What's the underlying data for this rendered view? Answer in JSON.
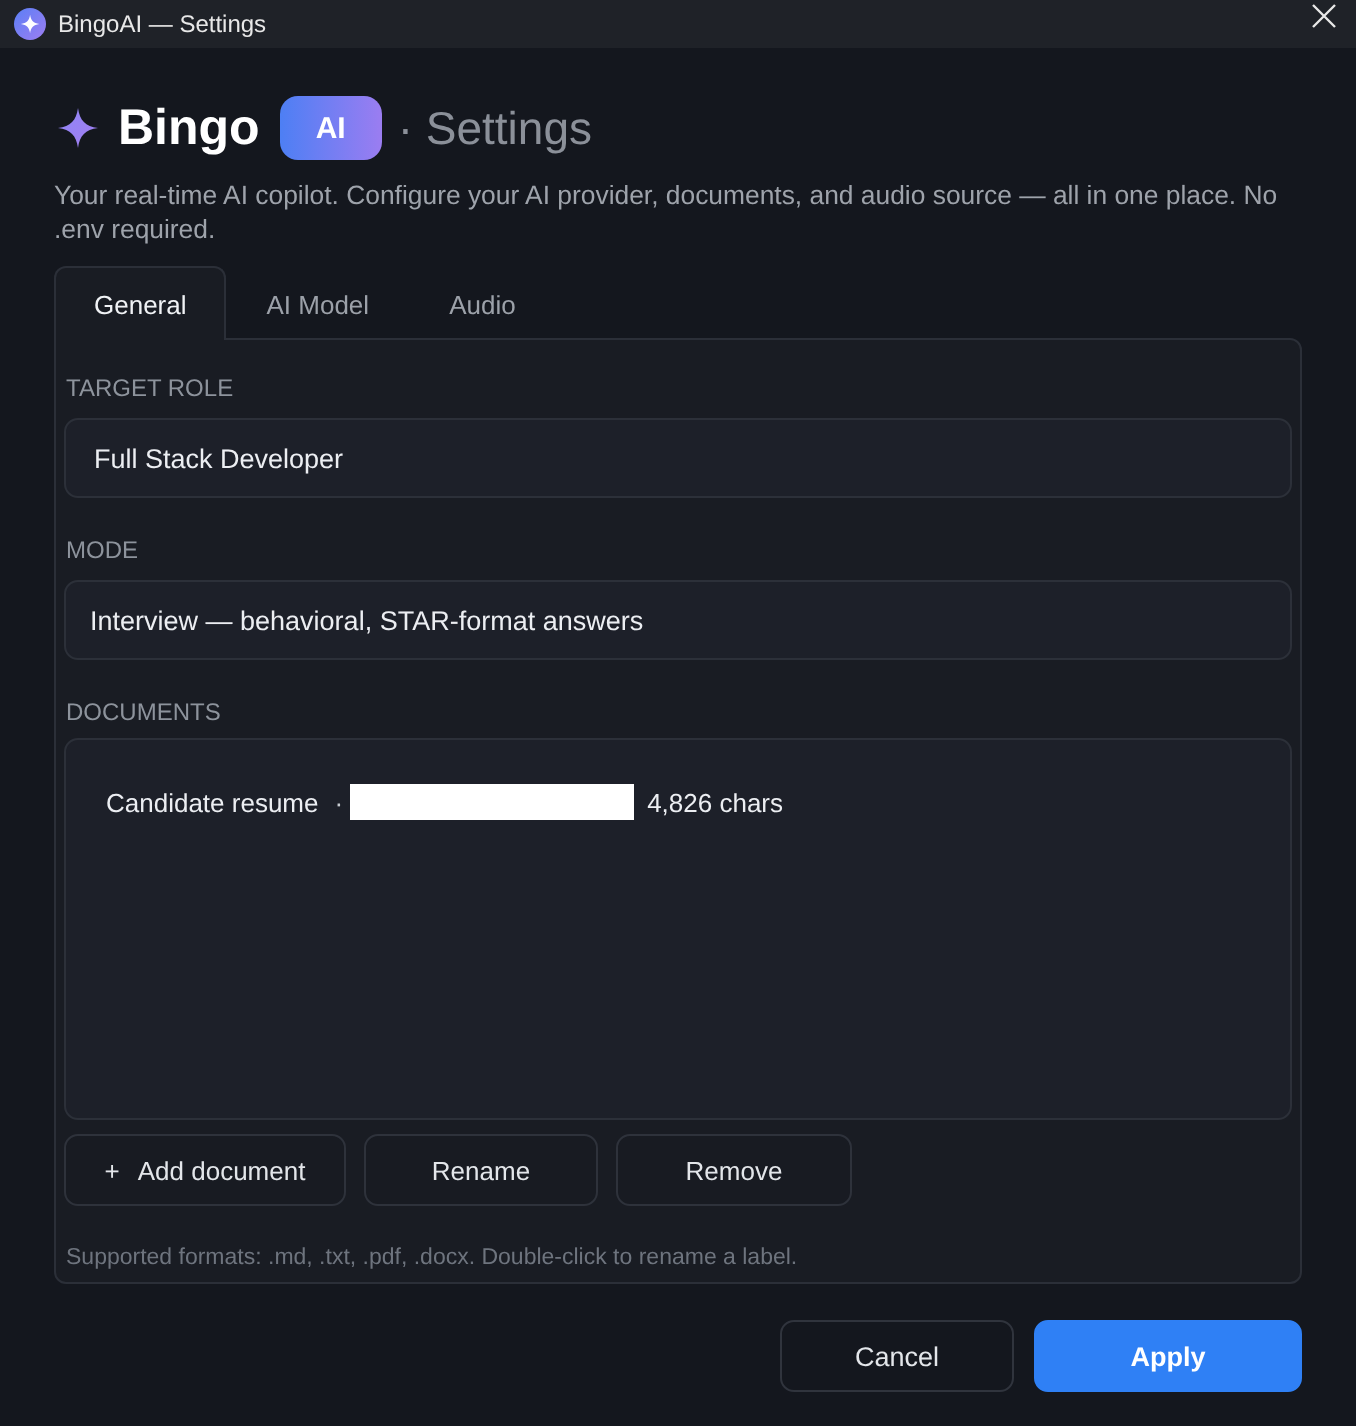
{
  "window": {
    "title": "BingoAI — Settings"
  },
  "header": {
    "brand": "Bingo",
    "badge": "AI",
    "page": "· Settings",
    "description": "Your real-time AI copilot. Configure your AI provider, documents, and audio source — all in one place. No .env required."
  },
  "tabs": [
    {
      "label": "General",
      "selected": true
    },
    {
      "label": "AI Model",
      "selected": false
    },
    {
      "label": "Audio",
      "selected": false
    }
  ],
  "fields": [
    {
      "label": "TARGET ROLE",
      "value": "Full Stack Developer"
    },
    {
      "label": "MODE",
      "value": "Interview — behavioral, STAR-format answers"
    }
  ],
  "documents": {
    "label": "DOCUMENTS",
    "items": [
      {
        "name": "Candidate resume",
        "separator": "·",
        "redacted": true,
        "size": "4,826 chars",
        "selected": false
      }
    ]
  },
  "document_buttons": [
    {
      "prefix": "+",
      "label": "Add document"
    },
    {
      "label": "Rename"
    },
    {
      "label": "Remove"
    }
  ],
  "hint": "Supported formats: .md, .txt, .pdf, .docx. Double-click to rename a label.",
  "footer_buttons": [
    {
      "label": "Cancel",
      "kind": "secondary"
    },
    {
      "label": "Apply",
      "kind": "primary"
    }
  ]
}
